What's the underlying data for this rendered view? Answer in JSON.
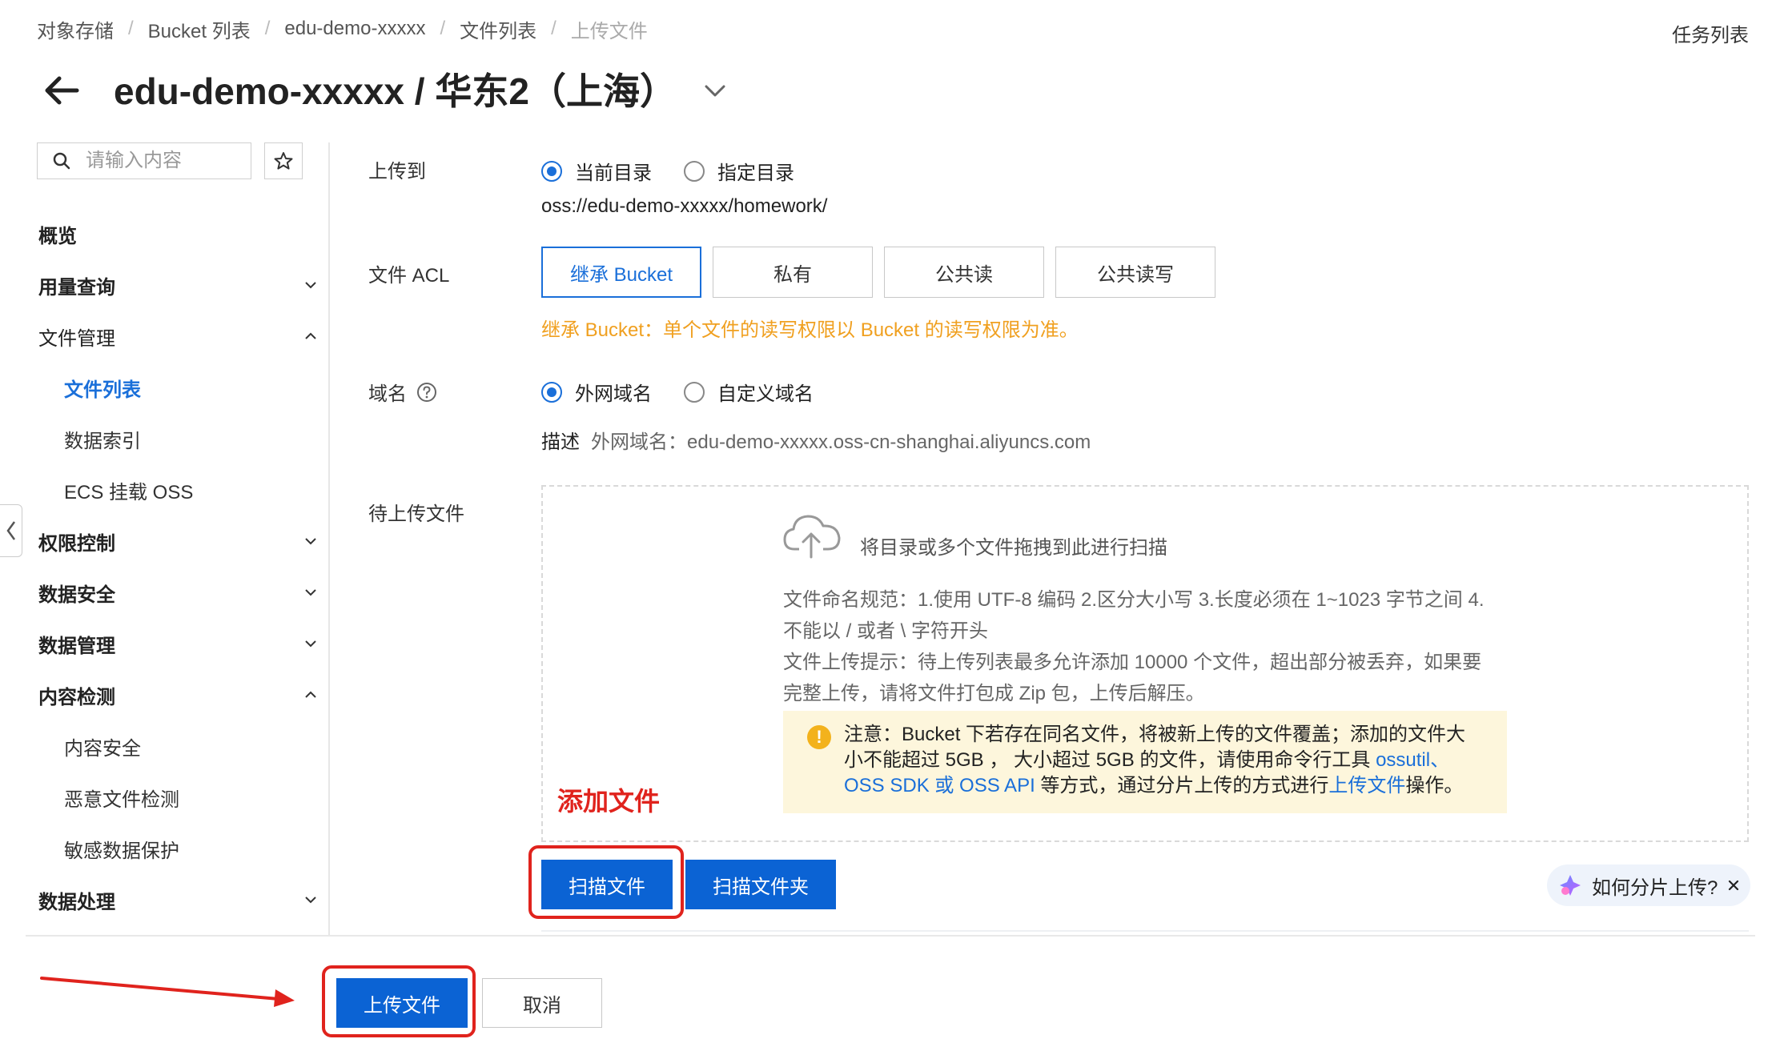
{
  "breadcrumb": {
    "items": [
      "对象存储",
      "Bucket 列表",
      "edu-demo-xxxxx",
      "文件列表"
    ],
    "current": "上传文件"
  },
  "header": {
    "task_list": "任务列表",
    "title": "edu-demo-xxxxx / 华东2（上海）"
  },
  "sidebar": {
    "search_placeholder": "请输入内容",
    "items": [
      {
        "label": "概览"
      },
      {
        "label": "用量查询"
      },
      {
        "label": "文件管理"
      },
      {
        "label": "文件列表"
      },
      {
        "label": "数据索引"
      },
      {
        "label": "ECS 挂载 OSS"
      },
      {
        "label": "权限控制"
      },
      {
        "label": "数据安全"
      },
      {
        "label": "数据管理"
      },
      {
        "label": "内容检测"
      },
      {
        "label": "内容安全"
      },
      {
        "label": "恶意文件检测"
      },
      {
        "label": "敏感数据保护"
      },
      {
        "label": "数据处理"
      }
    ]
  },
  "form": {
    "upload_to": {
      "label": "上传到",
      "options": [
        "当前目录",
        "指定目录"
      ],
      "selected": "当前目录",
      "path": "oss://edu-demo-xxxxx/homework/"
    },
    "acl": {
      "label": "文件 ACL",
      "options": [
        "继承 Bucket",
        "私有",
        "公共读",
        "公共读写"
      ],
      "selected": "继承 Bucket",
      "hint": "继承 Bucket：单个文件的读写权限以 Bucket 的读写权限为准。"
    },
    "domain": {
      "label": "域名",
      "options": [
        "外网域名",
        "自定义域名"
      ],
      "selected": "外网域名",
      "desc_label": "描述",
      "desc_value": "外网域名：edu-demo-xxxxx.oss-cn-shanghai.aliyuncs.com"
    },
    "pending": {
      "label": "待上传文件",
      "drop_text": "将目录或多个文件拖拽到此进行扫描",
      "rule_line1": "文件命名规范：1.使用 UTF-8 编码 2.区分大小写 3.长度必须在 1~1023 字节之间 4.",
      "rule_line2": "不能以 / 或者 \\ 字符开头",
      "tip_line1": "文件上传提示：待上传列表最多允许添加 10000 个文件，超出部分被丢弃，如果要",
      "tip_line2": "完整上传，请将文件打包成 Zip 包，上传后解压。",
      "notice_line1": "注意：Bucket 下若存在同名文件，将被新上传的文件覆盖；添加的文件大",
      "notice_line2": "小不能超过 5GB ， 大小超过 5GB 的文件，请使用命令行工具 ",
      "notice_link1": "ossutil、",
      "notice_link2": "OSS SDK 或 OSS API",
      "notice_line3": " 等方式，通过分片上传的方式进行",
      "notice_link3": "上传文件",
      "notice_line3_end": "操作。",
      "annotation": "添加文件",
      "scan_files": "扫描文件",
      "scan_folder": "扫描文件夹",
      "help": "如何分片上传?"
    }
  },
  "footer": {
    "upload": "上传文件",
    "cancel": "取消"
  },
  "colors": {
    "primary": "#0b63d4",
    "link": "#1a6fd9",
    "warning": "#f0a020",
    "annotation_red": "#e0231d"
  }
}
